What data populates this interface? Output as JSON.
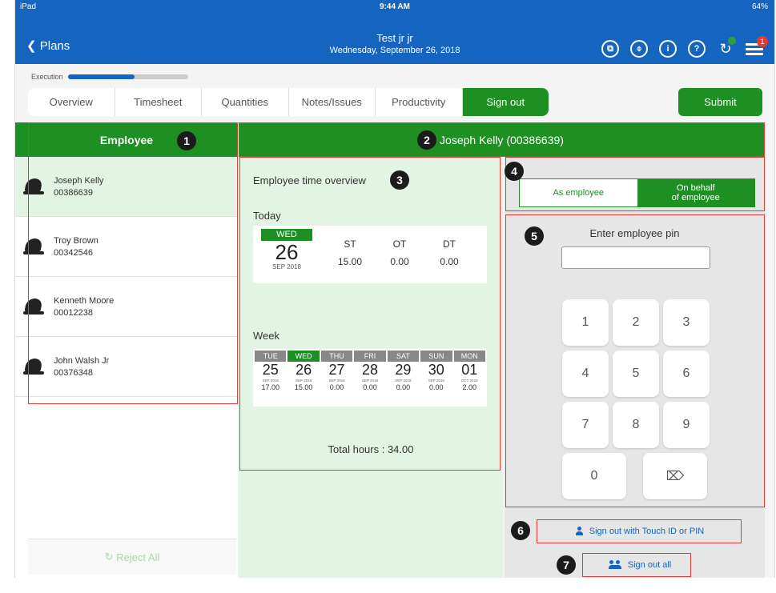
{
  "status_bar": {
    "left": "iPad",
    "time": "9:44 AM",
    "battery": "64%"
  },
  "header": {
    "back_label": "Plans",
    "title": "Test jr jr",
    "subtitle": "Wednesday, September 26, 2018",
    "notification_count": "1"
  },
  "progress": {
    "label": "Execution",
    "percent": 0.55
  },
  "tabs": [
    "Overview",
    "Timesheet",
    "Quantities",
    "Notes/Issues",
    "Productivity",
    "Sign out"
  ],
  "active_tab": "Sign out",
  "submit_label": "Submit",
  "employee_panel": {
    "header": "Employee",
    "employees": [
      {
        "name": "Joseph Kelly",
        "id": "00386639"
      },
      {
        "name": "Troy Brown",
        "id": "00342546"
      },
      {
        "name": "Kenneth Moore",
        "id": "00012238"
      },
      {
        "name": "John Walsh Jr",
        "id": "00376348"
      }
    ],
    "reject_label": "Reject All"
  },
  "selected_employee": "Joseph Kelly (00386639)",
  "overview": {
    "title": "Employee time overview",
    "today_label": "Today",
    "today": {
      "dow": "WED",
      "day": "26",
      "month": "SEP 2018"
    },
    "today_cols": [
      {
        "label": "ST",
        "value": "15.00"
      },
      {
        "label": "OT",
        "value": "0.00"
      },
      {
        "label": "DT",
        "value": "0.00"
      }
    ],
    "week_label": "Week",
    "week": [
      {
        "dow": "TUE",
        "day": "25",
        "sub": "SEP 2018",
        "hrs": "17.00"
      },
      {
        "dow": "WED",
        "day": "26",
        "sub": "SEP 2018",
        "hrs": "15.00"
      },
      {
        "dow": "THU",
        "day": "27",
        "sub": "SEP 2018",
        "hrs": "0.00"
      },
      {
        "dow": "FRI",
        "day": "28",
        "sub": "SEP 2018",
        "hrs": "0.00"
      },
      {
        "dow": "SAT",
        "day": "29",
        "sub": "SEP 2018",
        "hrs": "0.00"
      },
      {
        "dow": "SUN",
        "day": "30",
        "sub": "SEP 2018",
        "hrs": "0.00"
      },
      {
        "dow": "MON",
        "day": "01",
        "sub": "OCT 2018",
        "hrs": "2.00"
      }
    ],
    "total": "Total hours : 34.00"
  },
  "signout": {
    "as_employee": "As employee",
    "on_behalf_line1": "On behalf",
    "on_behalf_line2": "of employee",
    "pin_label": "Enter employee pin",
    "keys": [
      "1",
      "2",
      "3",
      "4",
      "5",
      "6",
      "7",
      "8",
      "9",
      "0"
    ],
    "touch_label": "Sign out with Touch ID or PIN",
    "all_label": "Sign out all"
  },
  "markers": [
    "1",
    "2",
    "3",
    "4",
    "5",
    "6",
    "7"
  ],
  "colors": {
    "header_blue": "#1565c0",
    "green": "#1e8f23",
    "light_green": "#e3f3e4",
    "annotation_red": "#e53935"
  }
}
